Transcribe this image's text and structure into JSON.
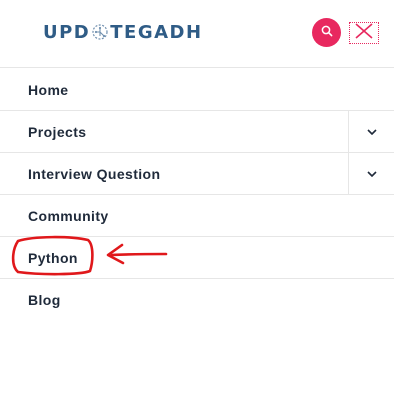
{
  "header": {
    "logo_left": "UPD",
    "logo_right": "TEGADH",
    "logo_icon": "circuit-brain-logo-icon",
    "search_icon": "search-icon",
    "close_icon": "close-icon",
    "accent_color": "#e8285f",
    "logo_color": "#2f5c86"
  },
  "menu": {
    "items": [
      {
        "label": "Home",
        "has_submenu": false
      },
      {
        "label": "Projects",
        "has_submenu": true,
        "toggle_icon": "chevron-down-icon"
      },
      {
        "label": "Interview Question",
        "has_submenu": true,
        "toggle_icon": "chevron-down-icon"
      },
      {
        "label": "Community",
        "has_submenu": false
      },
      {
        "label": "Python",
        "has_submenu": false
      },
      {
        "label": "Blog",
        "has_submenu": false
      }
    ]
  },
  "annotation": {
    "color": "#e0181b",
    "circled_item": "Python",
    "arrow_icon": "arrow-left-icon"
  }
}
